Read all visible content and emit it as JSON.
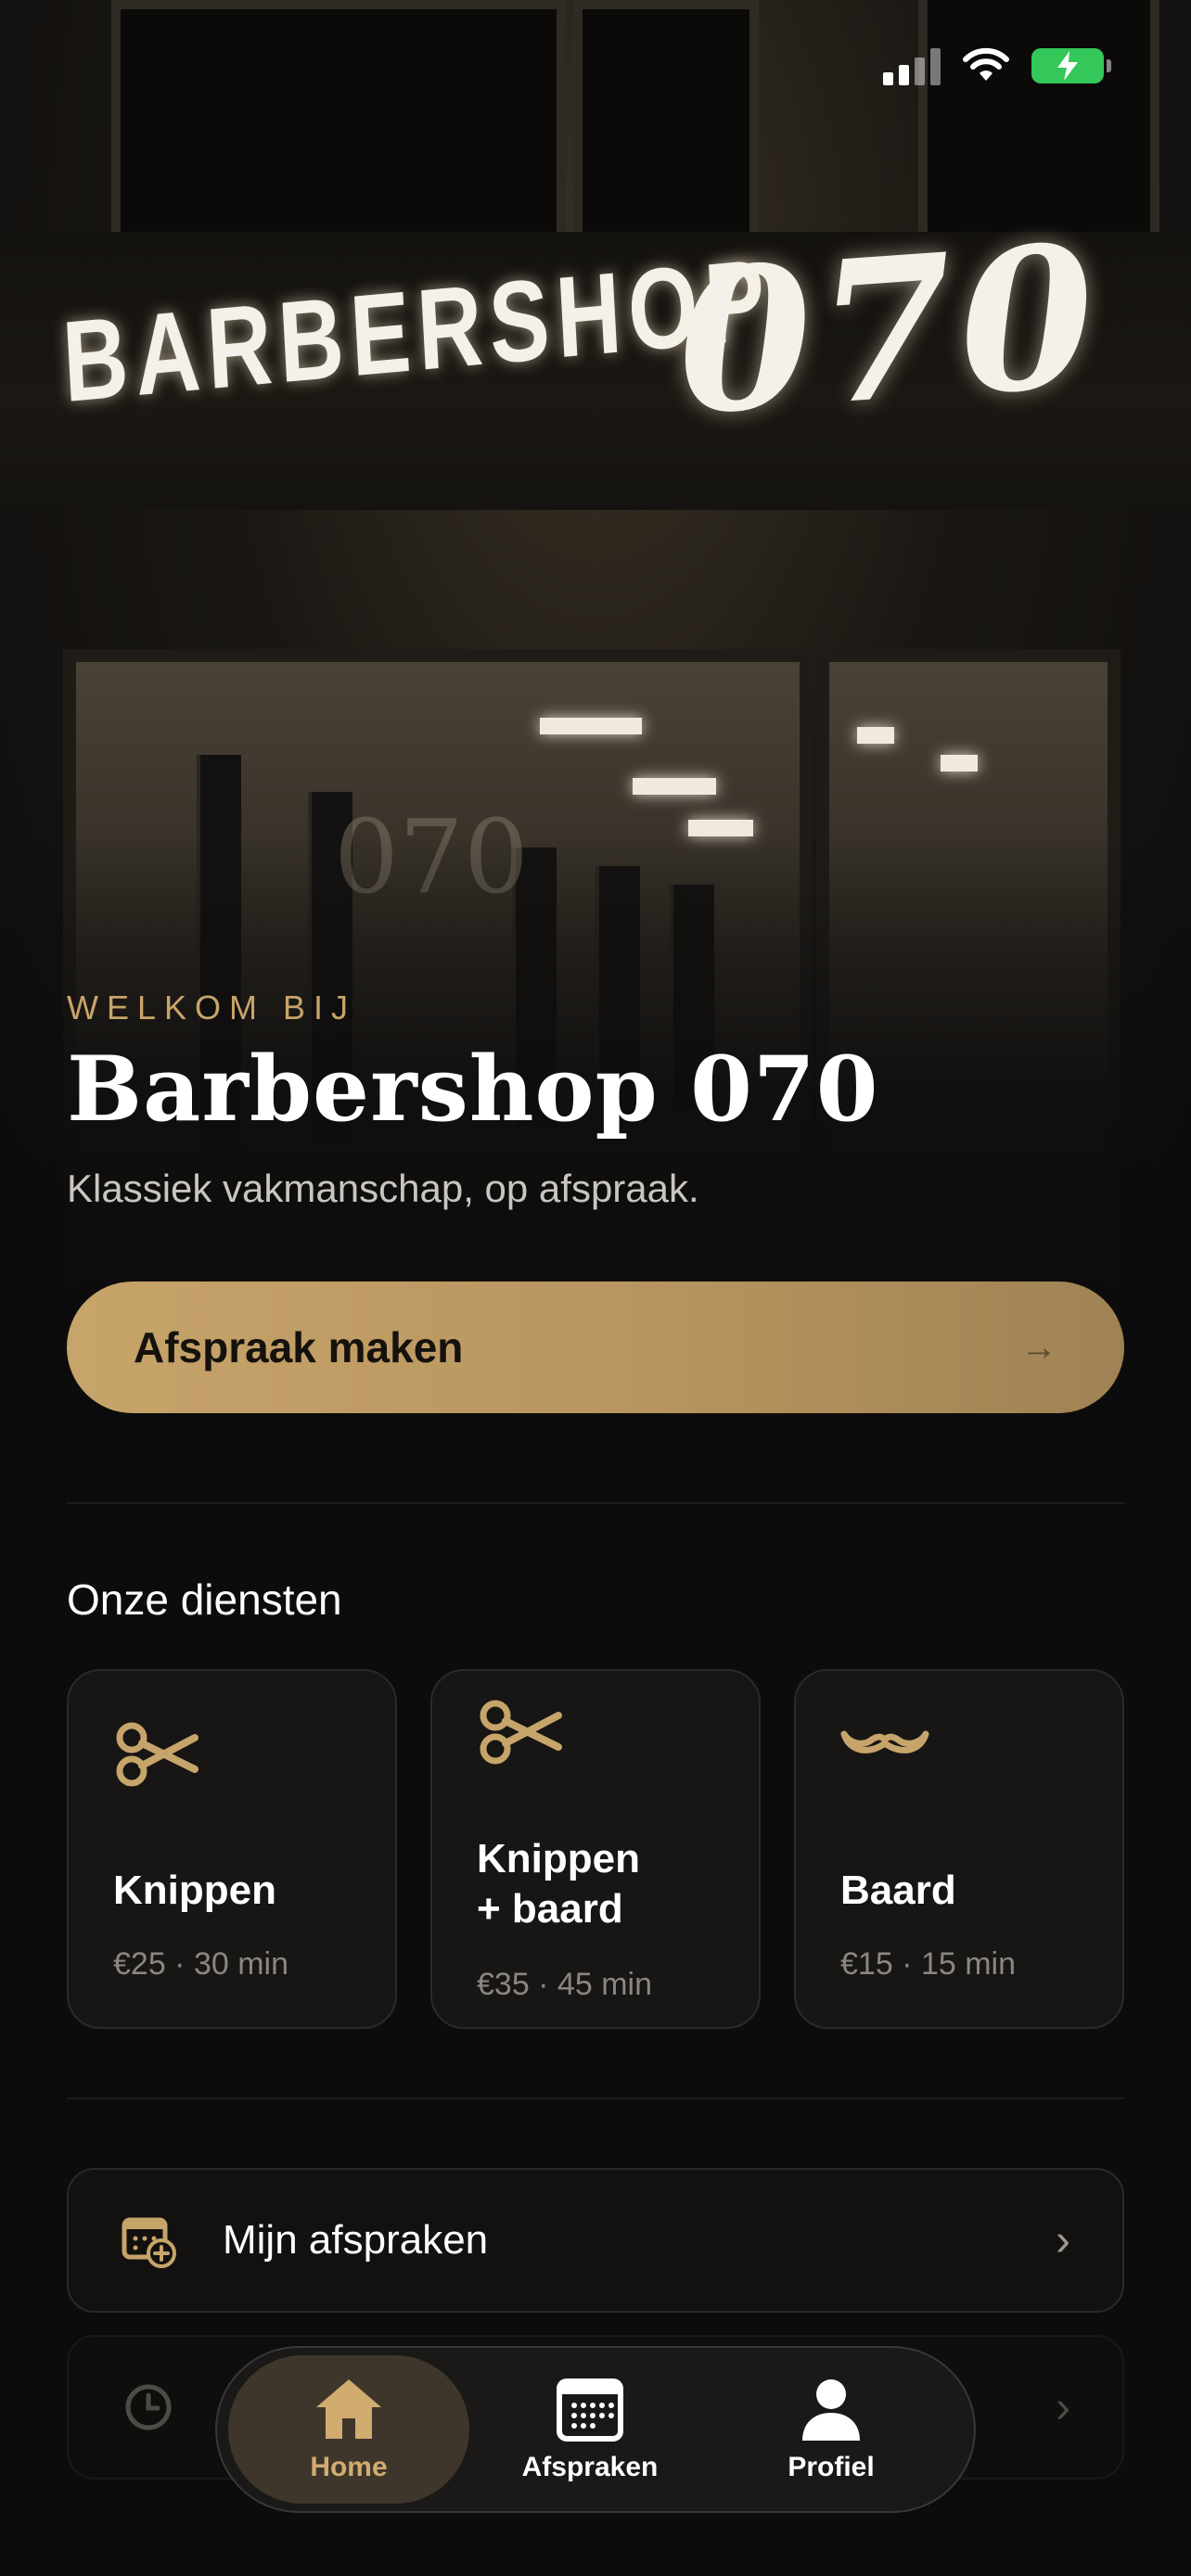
{
  "hero": {
    "sign_word": "BARBERSHOP",
    "sign_number": "070",
    "wall_logo": "070",
    "eyebrow": "WELKOM BIJ",
    "title": "Barbershop 070",
    "subtitle": "Klassiek vakmanschap, op afspraak."
  },
  "cta": {
    "label": "Afspraak maken",
    "arrow": "→"
  },
  "services": {
    "heading": "Onze diensten",
    "items": [
      {
        "name": "Knippen",
        "meta": "€25 · 30 min",
        "icon": "scissors-icon"
      },
      {
        "name": "Knippen\n+ baard",
        "name_line1": "Knippen",
        "name_line2": "+ baard",
        "meta": "€35 · 45 min",
        "icon": "scissors-icon"
      },
      {
        "name": "Baard",
        "meta": "€15 · 15 min",
        "icon": "mustache-icon"
      }
    ]
  },
  "links": {
    "my_appointments": {
      "label": "Mijn afspraken",
      "icon": "calendar-add-icon",
      "chevron": "›"
    },
    "second_row": {
      "icon": "clock-icon",
      "chevron": "›"
    }
  },
  "tabbar": {
    "tabs": [
      {
        "label": "Home",
        "icon": "home-icon",
        "active": true
      },
      {
        "label": "Afspraken",
        "icon": "calendar-icon",
        "active": false
      },
      {
        "label": "Profiel",
        "icon": "person-icon",
        "active": false
      }
    ]
  },
  "colors": {
    "accent": "#C7A46A",
    "background": "#0D0C0C",
    "battery": "#34C759"
  }
}
